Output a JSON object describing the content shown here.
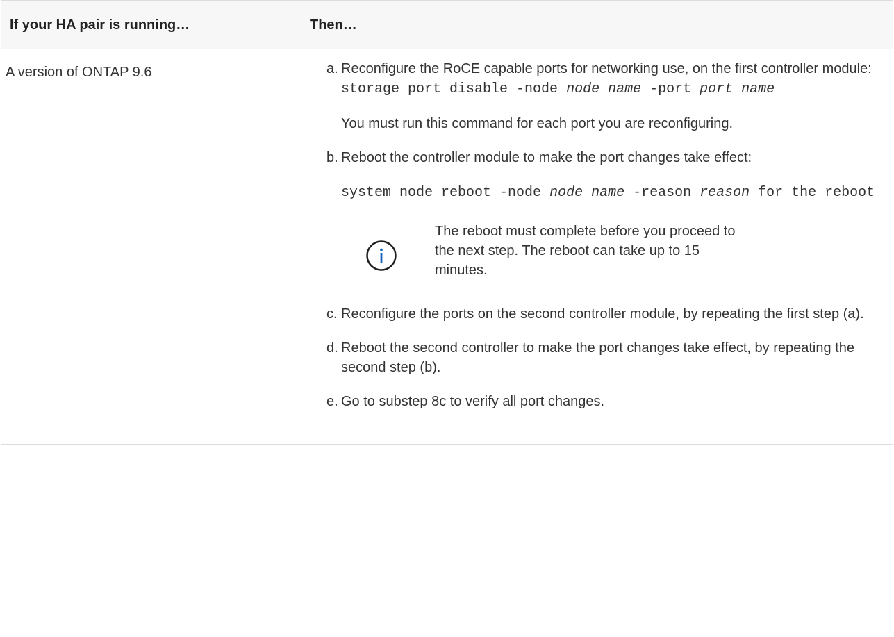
{
  "table": {
    "header": {
      "col1": "If your HA pair is running…",
      "col2": "Then…"
    },
    "row": {
      "condition": "A version of ONTAP 9.6",
      "steps": {
        "a": {
          "marker": "a.",
          "text_before": "Reconfigure the RoCE capable ports for networking use, on the first controller module: ",
          "cmd_1": "storage port disable -node ",
          "cmd_em_1": "node name",
          "cmd_2": " -port ",
          "cmd_em_2": "port name",
          "note": "You must run this command for each port you are reconfiguring."
        },
        "b": {
          "marker": "b.",
          "text": "Reboot the controller module to make the port changes take effect:",
          "cmd_1": "system node reboot -node ",
          "cmd_em_1": "node name",
          "cmd_2": " -reason ",
          "cmd_em_2": "reason",
          "cmd_3": " for the reboot",
          "admonition": {
            "icon": "info-icon",
            "icon_color": "#1463c0",
            "text": "The reboot must complete before you proceed to the next step. The reboot can take up to 15 minutes."
          }
        },
        "c": {
          "marker": "c.",
          "text": "Reconfigure the ports on the second controller module, by repeating the first step (a)."
        },
        "d": {
          "marker": "d.",
          "text": "Reboot the second controller to make the port changes take effect, by repeating the second step (b)."
        },
        "e": {
          "marker": "e.",
          "text": "Go to substep 8c to verify all port changes."
        }
      }
    }
  }
}
